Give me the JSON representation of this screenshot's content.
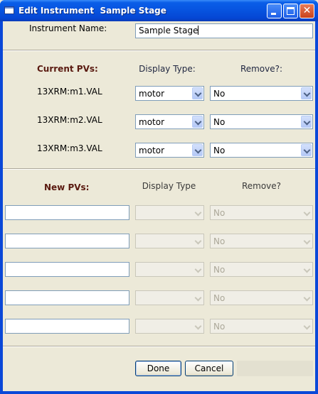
{
  "window": {
    "title": "Edit Instrument  Sample Stage"
  },
  "instrument": {
    "label": "Instrument Name:",
    "value": "Sample Stage"
  },
  "current": {
    "heading": "Current PVs:",
    "display_type_header": "Display Type:",
    "remove_header": "Remove?:",
    "rows": [
      {
        "pv": "13XRM:m1.VAL",
        "display_type": "motor",
        "remove": "No"
      },
      {
        "pv": "13XRM:m2.VAL",
        "display_type": "motor",
        "remove": "No"
      },
      {
        "pv": "13XRM:m3.VAL",
        "display_type": "motor",
        "remove": "No"
      }
    ]
  },
  "new": {
    "heading": "New PVs:",
    "display_type_header": "Display Type",
    "remove_header": "Remove?",
    "rows": [
      {
        "pv": "",
        "display_type": "",
        "remove": "No"
      },
      {
        "pv": "",
        "display_type": "",
        "remove": "No"
      },
      {
        "pv": "",
        "display_type": "",
        "remove": "No"
      },
      {
        "pv": "",
        "display_type": "",
        "remove": "No"
      },
      {
        "pv": "",
        "display_type": "",
        "remove": "No"
      }
    ]
  },
  "buttons": {
    "done": "Done",
    "cancel": "Cancel"
  }
}
